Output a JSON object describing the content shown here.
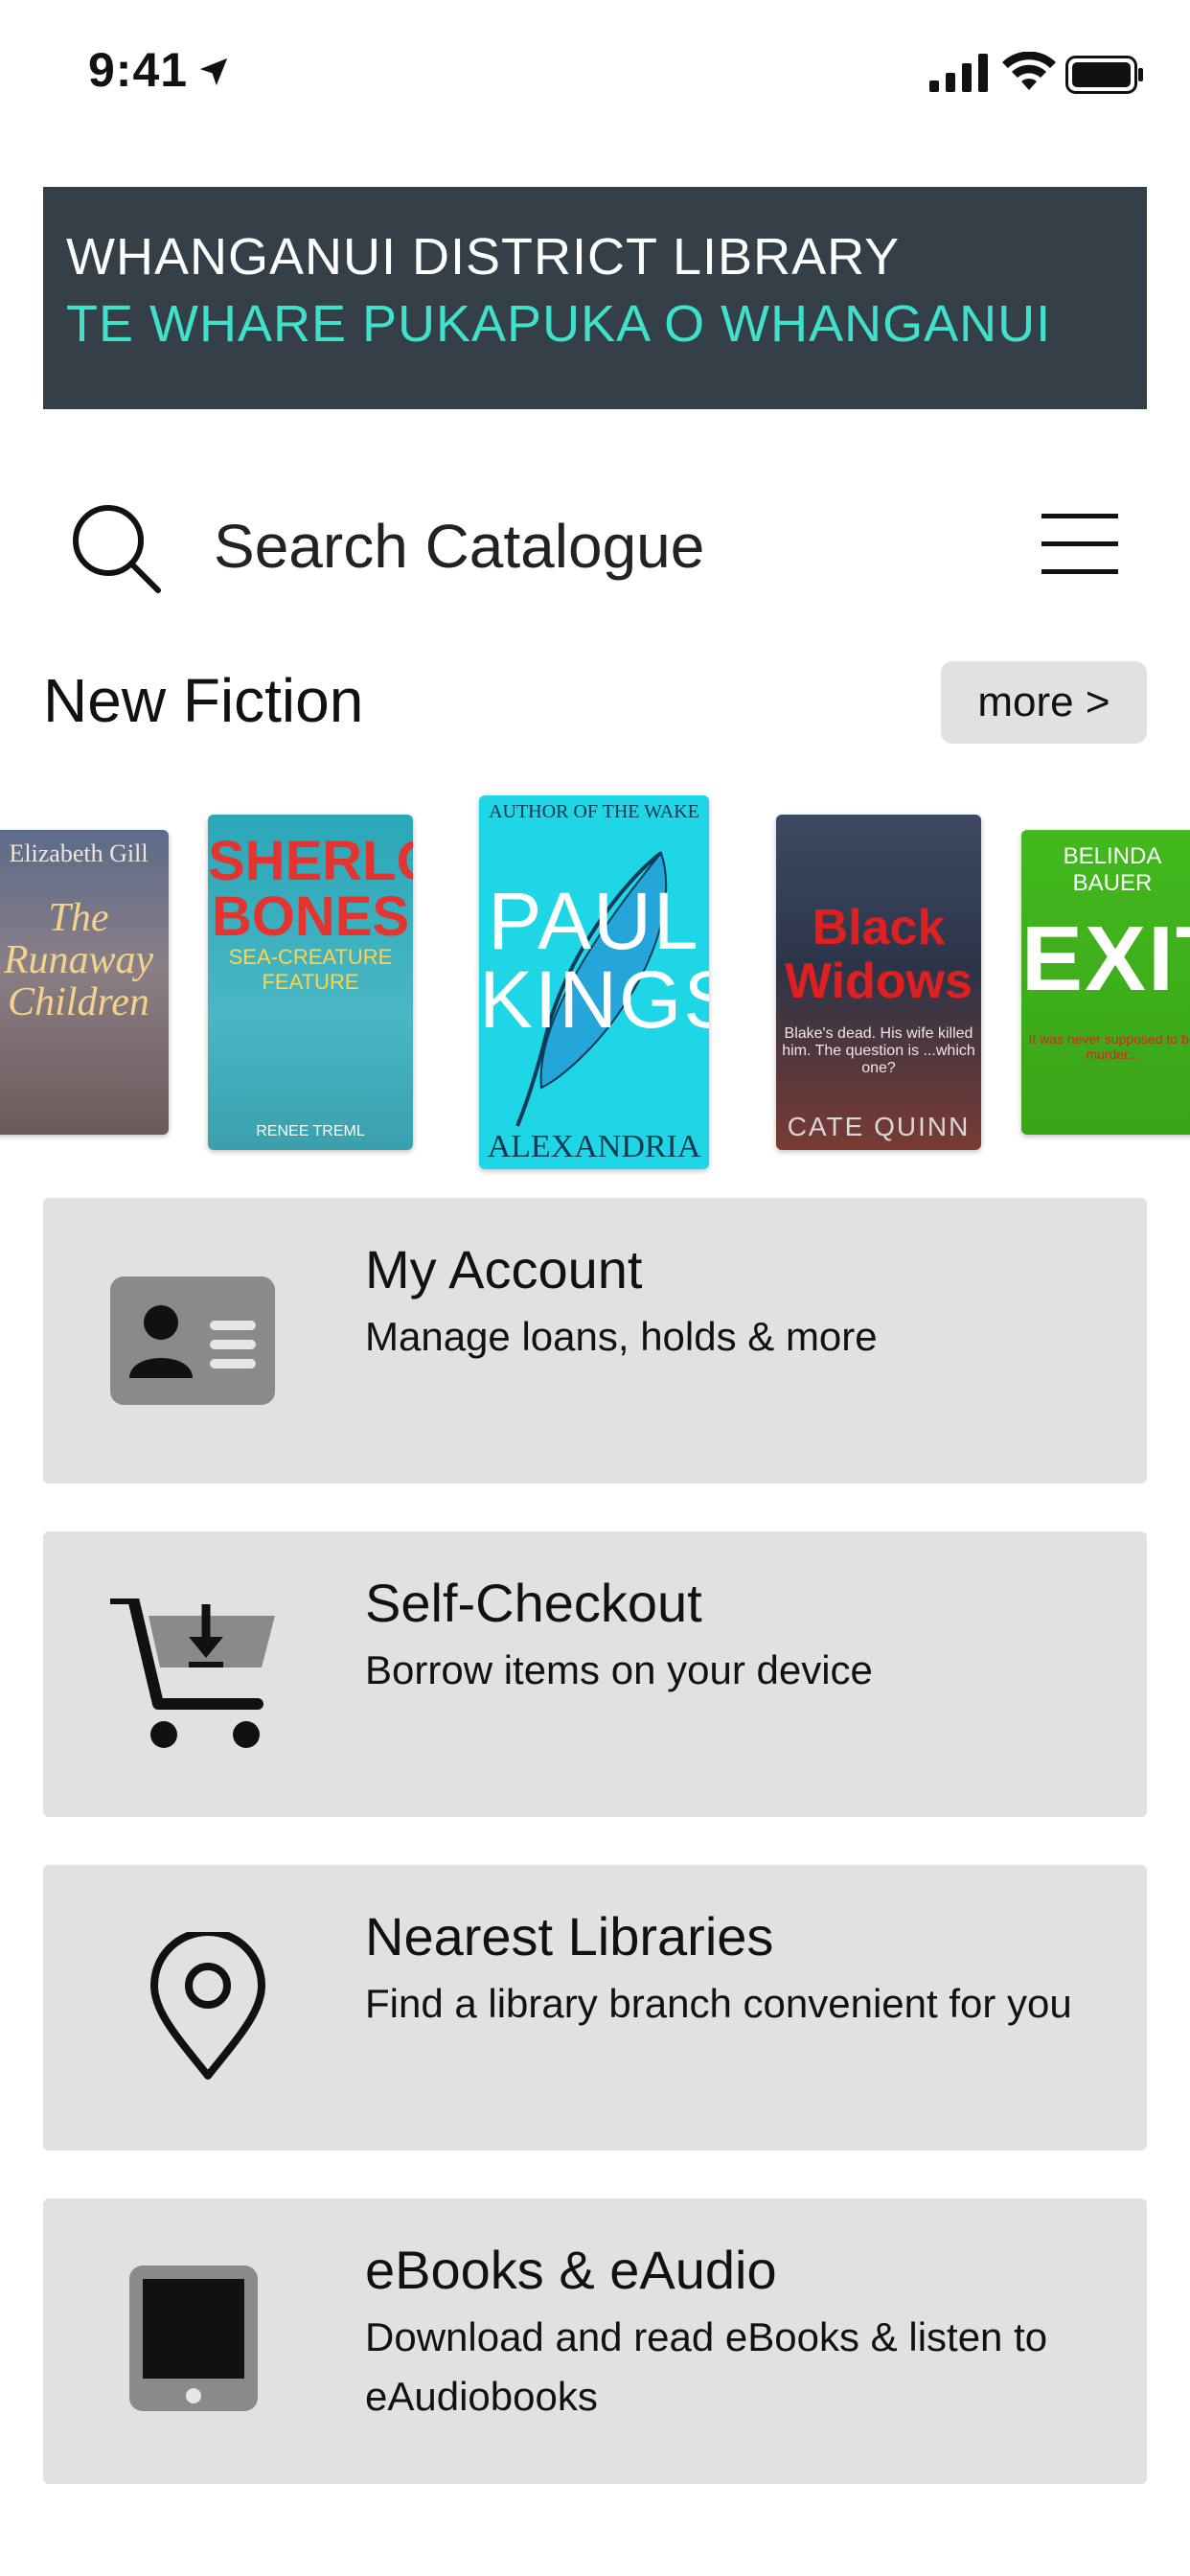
{
  "status_bar": {
    "time": "9:41"
  },
  "banner": {
    "line1": "WHANGANUI DISTRICT LIBRARY",
    "line2": "TE WHARE PUKAPUKA O WHANGANUI",
    "background_color": "#343f47",
    "accent_color": "#3fe0cc"
  },
  "search": {
    "placeholder": "Search Catalogue",
    "value": ""
  },
  "new_fiction": {
    "title": "New Fiction",
    "more_label": "more >",
    "books": [
      {
        "author": "Elizabeth Gill",
        "title": "The Runaway Children"
      },
      {
        "title": "SHERLOCK BONES",
        "subtitle": "SEA-CREATURE FEATURE",
        "author": "RENEE TREML"
      },
      {
        "top_text": "AUTHOR OF THE WAKE",
        "title": "PAUL KINGSNORTH",
        "subtitle": "ALEXANDRIA"
      },
      {
        "title": "Black Widows",
        "subtitle": "Blake's dead. His wife killed him. The question is ...which one?",
        "author": "CATE QUINN"
      },
      {
        "author": "BELINDA BAUER",
        "title": "EXIT",
        "subtitle": "It was never supposed to be murder..."
      }
    ]
  },
  "cards": [
    {
      "title": "My Account",
      "subtitle": "Manage loans, holds & more",
      "icon": "id-card-icon"
    },
    {
      "title": "Self-Checkout",
      "subtitle": "Borrow items on your device",
      "icon": "cart-download-icon"
    },
    {
      "title": "Nearest Libraries",
      "subtitle": "Find a library branch convenient for you",
      "icon": "map-pin-icon"
    },
    {
      "title": "eBooks & eAudio",
      "subtitle": "Download and read eBooks & listen to eAudiobooks",
      "icon": "tablet-icon"
    }
  ],
  "colors": {
    "card_bg": "#e1e1e1",
    "more_bg": "#e1e1e1"
  }
}
